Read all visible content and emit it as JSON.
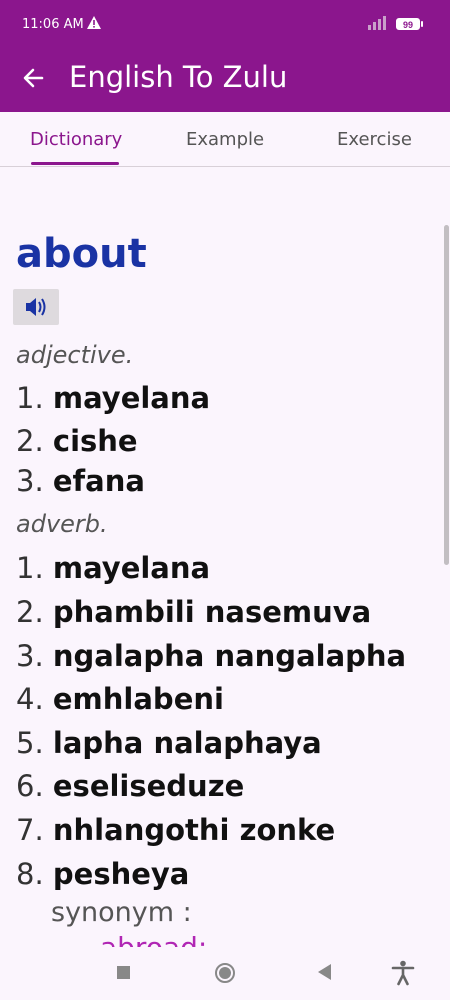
{
  "status": {
    "time": "11:06 AM",
    "battery": "99"
  },
  "appbar": {
    "title": "English To Zulu"
  },
  "tabs": [
    {
      "label": "Dictionary"
    },
    {
      "label": "Example"
    },
    {
      "label": "Exercise"
    }
  ],
  "entry": {
    "word": "about",
    "groups": [
      {
        "pos": "adjective.",
        "meanings": [
          "mayelana",
          "cishe",
          "efana"
        ]
      },
      {
        "pos": "adverb.",
        "meanings": [
          "mayelana",
          "phambili nasemuva",
          "ngalapha nangalapha",
          "emhlabeni",
          "lapha nalaphaya",
          "eseliseduze",
          "nhlangothi zonke",
          "pesheya"
        ]
      }
    ],
    "synonym_label": "synonym :",
    "synonym_value": "abroad;"
  },
  "colors": {
    "primary": "#8b168d",
    "word": "#1a33a4",
    "background": "#fbf5fd"
  }
}
